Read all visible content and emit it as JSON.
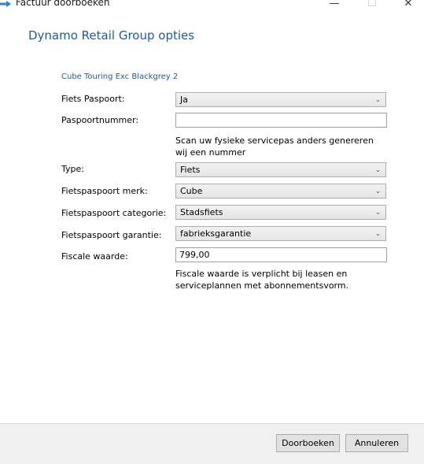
{
  "window": {
    "title": "Factuur doorboeken",
    "minimize_glyph": "—",
    "maximize_glyph": "☐",
    "close_glyph": "✕",
    "app_icon": "arrow-icon"
  },
  "dialog": {
    "heading": "Dynamo Retail Group opties",
    "product_name": "Cube Touring Exc Blackgrey 2"
  },
  "fields": {
    "paspoort": {
      "label": "Fiets Paspoort:",
      "value": "Ja"
    },
    "paspoortnummer": {
      "label": "Paspoortnummer:",
      "value": ""
    },
    "paspoortnummer_hint": "Scan uw fysieke servicepas anders genereren wij een nummer",
    "type": {
      "label": "Type:",
      "value": "Fiets"
    },
    "merk": {
      "label": "Fietspaspoort merk:",
      "value": "Cube"
    },
    "categorie": {
      "label": "Fietspaspoort categorie:",
      "value": "Stadsfiets"
    },
    "garantie": {
      "label": "Fietspaspoort garantie:",
      "value": "fabrieksgarantie"
    },
    "fiscale_waarde": {
      "label": "Fiscale waarde:",
      "value": "799,00"
    },
    "fiscale_hint": "Fiscale waarde is verplicht bij leasen en serviceplannen met abonnementsvorm."
  },
  "buttons": {
    "book": "Doorboeken",
    "cancel": "Annuleren"
  },
  "colors": {
    "accent": "#1e5aa0",
    "footer_bg": "#f0f0f0"
  },
  "icons": {
    "dropdown": "chevron-down-icon"
  }
}
